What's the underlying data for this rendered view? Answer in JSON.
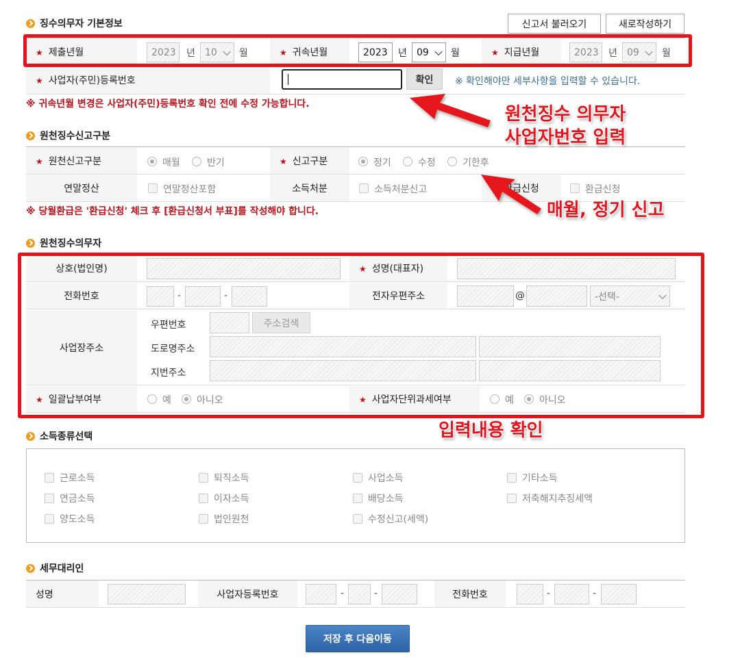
{
  "top_buttons": {
    "load": "신고서 불러오기",
    "new": "새로작성하기"
  },
  "basic": {
    "title": "징수의무자 기본정보",
    "submit_label": "제출년월",
    "submit_year": "2023",
    "submit_month": "10",
    "belong_label": "귀속년월",
    "belong_year": "2023",
    "belong_month": "09",
    "pay_label": "지급년월",
    "pay_year": "2023",
    "pay_month": "09",
    "year_unit": "년",
    "month_unit": "월",
    "biz_label": "사업자(주민)등록번호",
    "confirm_btn": "확인",
    "hint": "※ 확인해야만 세부사항을 입력할 수 있습니다.",
    "warn": "※ 귀속년월 변경은 사업자(주민)등록번호 확인 전에 수정 가능합니다."
  },
  "report_type": {
    "title": "원천징수신고구분",
    "type_label": "원천신고구분",
    "type_opts": [
      "매월",
      "반기"
    ],
    "kind_label": "신고구분",
    "kind_opts": [
      "정기",
      "수정",
      "기한후"
    ],
    "year_end_label": "연말정산",
    "year_end_opt": "연말정산포함",
    "disposal_label": "소득처분",
    "disposal_opt": "소득처분신고",
    "refund_label": "환급신청",
    "refund_opt": "환급신청",
    "warn": "※ 당월환급은 '환급신청' 체크 후 [환급신청서 부표]를 작성해야 합니다."
  },
  "agent": {
    "title": "원천징수의무자",
    "company_label": "상호(법인명)",
    "ceo_label": "성명(대표자)",
    "phone_label": "전화번호",
    "email_label": "전자우편주소",
    "email_at": "@",
    "email_select": "-선택-",
    "dash": "-",
    "addr_label": "사업장주소",
    "zip_label": "우편번호",
    "zip_btn": "주소검색",
    "road_label": "도로명주소",
    "lot_label": "지번주소",
    "bulk_label": "일괄납부여부",
    "bulk_opts": [
      "예",
      "아니오"
    ],
    "unit_label": "사업자단위과세여부",
    "unit_opts": [
      "예",
      "아니오"
    ]
  },
  "income": {
    "title": "소득종류선택",
    "items": [
      "근로소득",
      "퇴직소득",
      "사업소득",
      "기타소득",
      "연금소득",
      "이자소득",
      "배당소득",
      "저축해지추징세액",
      "양도소득",
      "법인원천",
      "수정신고(세액)"
    ]
  },
  "tax_agent": {
    "title": "세무대리인",
    "name_label": "성명",
    "biz_label": "사업자등록번호",
    "phone_label": "전화번호"
  },
  "save_btn": "저장 후 다음이동",
  "annotations": {
    "arrow1_text_line1": "원천징수 의무자",
    "arrow1_text_line2": "사업자번호 입력",
    "arrow2_text": "매월, 정기 신고",
    "box2_text": "입력내용 확인",
    "color": "#e5131b"
  }
}
